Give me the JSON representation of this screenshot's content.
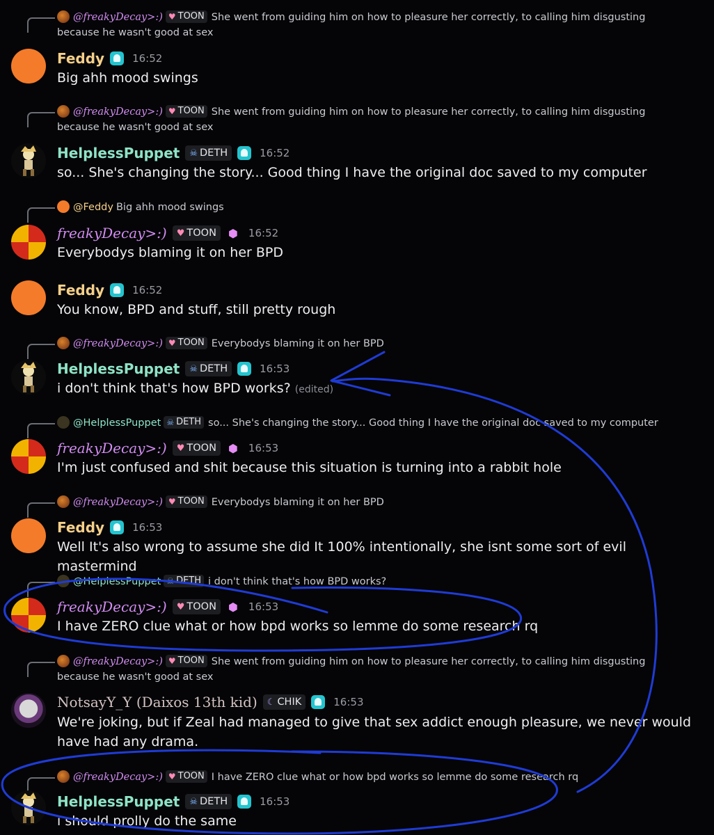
{
  "colors": {
    "background": "#050507",
    "feddy": "#f6d08a",
    "puppet": "#8fe3c7",
    "decay": "#d28cf2",
    "notsay": "#d4c3c3",
    "annotation": "#1f3bd6"
  },
  "messages": [
    {
      "reply": {
        "author": "@freakyDecay>:)",
        "tag": "TOON",
        "text": "She went from guiding him on how to pleasure her correctly, to calling him disgusting because he wasn't good at sex"
      },
      "author": "Feddy",
      "tag": "",
      "time": "16:52",
      "text": "Big ahh mood swings",
      "edited": ""
    },
    {
      "reply": {
        "author": "@freakyDecay>:)",
        "tag": "TOON",
        "text": "She went from guiding him on how to pleasure her correctly, to calling him disgusting because he wasn't good at sex"
      },
      "author": "HelplessPuppet",
      "tag": "DETH",
      "time": "16:52",
      "text": "so... She's changing the story... Good thing I have the original doc saved to my computer",
      "edited": ""
    },
    {
      "reply": {
        "author": "@Feddy",
        "tag": "",
        "text": "Big ahh mood swings"
      },
      "author": "freakyDecay>:)",
      "tag": "TOON",
      "time": "16:52",
      "text": "Everybodys blaming it on her BPD",
      "edited": ""
    },
    {
      "reply": null,
      "author": "Feddy",
      "tag": "",
      "time": "16:52",
      "text": "You know, BPD and stuff, still pretty rough",
      "edited": ""
    },
    {
      "reply": {
        "author": "@freakyDecay>:)",
        "tag": "TOON",
        "text": "Everybodys blaming it on her BPD"
      },
      "author": "HelplessPuppet",
      "tag": "DETH",
      "time": "16:53",
      "text": "i don't think that's how BPD works?",
      "edited": "(edited)"
    },
    {
      "reply": {
        "author": "@HelplessPuppet",
        "tag": "DETH",
        "text": "so... She's changing the story... Good thing I have the original doc saved to my computer"
      },
      "author": "freakyDecay>:)",
      "tag": "TOON",
      "time": "16:53",
      "text": "I'm just confused and shit because this situation is turning into a rabbit hole",
      "edited": ""
    },
    {
      "reply": {
        "author": "@freakyDecay>:)",
        "tag": "TOON",
        "text": "Everybodys blaming it on her BPD"
      },
      "author": "Feddy",
      "tag": "",
      "time": "16:53",
      "text": "Well It's also wrong to assume she did It 100% intentionally, she isnt some sort of evil mastermind",
      "edited": ""
    },
    {
      "reply": {
        "author": "@HelplessPuppet",
        "tag": "DETH",
        "text": "i don't think that's how BPD works?"
      },
      "author": "freakyDecay>:)",
      "tag": "TOON",
      "time": "16:53",
      "text": "I have ZERO clue what or how bpd works so lemme do some research rq",
      "edited": ""
    },
    {
      "reply": {
        "author": "@freakyDecay>:)",
        "tag": "TOON",
        "text": "She went from guiding him on how to pleasure her correctly, to calling him disgusting because he wasn't good at sex"
      },
      "author": "NotsayY_Y (Daixos 13th kid)",
      "tag": "CHIK",
      "time": "16:53",
      "text": "We're joking, but if Zeal had managed to give that sex addict enough pleasure, we never would have had any drama.",
      "edited": ""
    },
    {
      "reply": {
        "author": "@freakyDecay>:)",
        "tag": "TOON",
        "text": "I have ZERO clue what or how bpd works so lemme do some research rq"
      },
      "author": "HelplessPuppet",
      "tag": "DETH",
      "time": "16:53",
      "text": "i should prolly do the same",
      "edited": ""
    }
  ]
}
